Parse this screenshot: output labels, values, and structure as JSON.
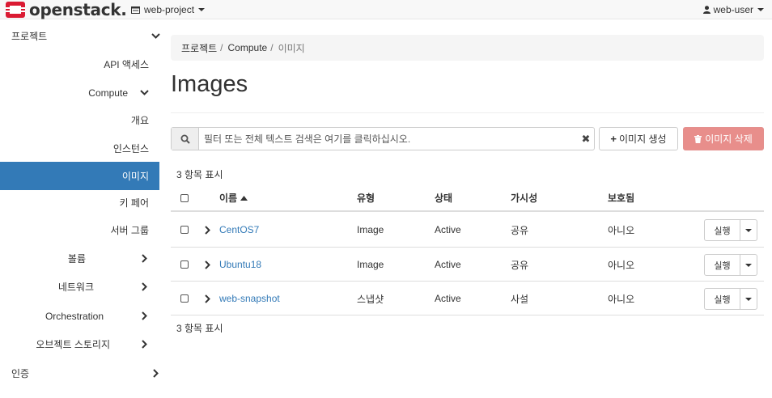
{
  "brand": {
    "logo_text": "openstack.",
    "logo_color": "#da1a32"
  },
  "topbar": {
    "project": "web-project",
    "user": "web-user"
  },
  "sidebar": {
    "project": "프로젝트",
    "api_access": "API 액세스",
    "compute": "Compute",
    "overview": "개요",
    "instances": "인스턴스",
    "images": "이미지",
    "keypairs": "키 페어",
    "server_groups": "서버 그룹",
    "volumes": "볼륨",
    "network": "네트워크",
    "orchestration": "Orchestration",
    "object_storage": "오브젝트 스토리지",
    "identity": "인증"
  },
  "breadcrumb": [
    "프로젝트",
    "Compute",
    "이미지"
  ],
  "page_title": "Images",
  "search": {
    "placeholder": "필터 또는 전체 텍스트 검색은 여기를 클릭하십시오."
  },
  "actions": {
    "create": "이미지 생성",
    "delete": "이미지 삭제"
  },
  "count_label": "3 항목 표시",
  "table": {
    "headers": {
      "name": "이름",
      "type": "유형",
      "status": "상태",
      "visibility": "가시성",
      "protected": "보호됨"
    },
    "rows": [
      {
        "name": "CentOS7",
        "type": "Image",
        "status": "Active",
        "visibility": "공유",
        "protected": "아니오",
        "action": "실행"
      },
      {
        "name": "Ubuntu18",
        "type": "Image",
        "status": "Active",
        "visibility": "공유",
        "protected": "아니오",
        "action": "실행"
      },
      {
        "name": "web-snapshot",
        "type": "스냅샷",
        "status": "Active",
        "visibility": "사설",
        "protected": "아니오",
        "action": "실행"
      }
    ]
  }
}
